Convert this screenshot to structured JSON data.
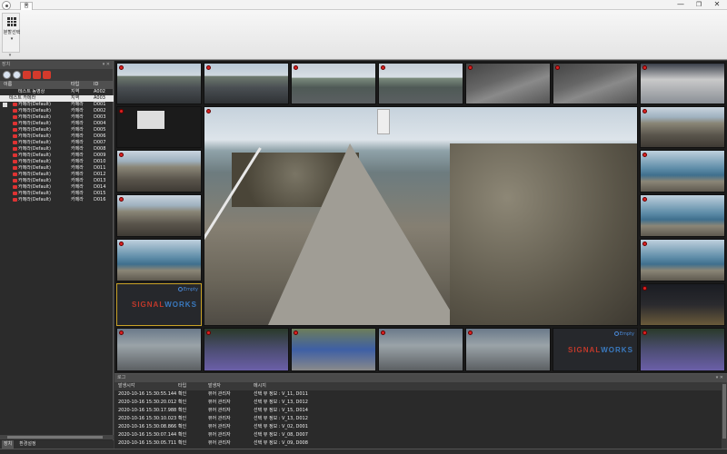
{
  "window": {
    "tab_label": "홈",
    "min_glyph": "—",
    "max_glyph": "❐",
    "close_glyph": "✕"
  },
  "ribbon": {
    "layout_button_label": "분할선택",
    "layout_caret": "▾",
    "expand_glyph": "▾"
  },
  "left_panel": {
    "title": "장치",
    "header_controls": "▾ ✕",
    "columns": {
      "name": "이름",
      "type": "타입",
      "id": "ID"
    },
    "rows": [
      {
        "name": "테스트 동영상",
        "type": "지역",
        "id": "A002",
        "kind": "group",
        "selected": false
      },
      {
        "name": "테스트 카메라",
        "type": "지역",
        "id": "A003",
        "kind": "group",
        "selected": true
      },
      {
        "name": "카메라(Default)",
        "type": "카메라",
        "id": "D001",
        "kind": "camera"
      },
      {
        "name": "카메라(Default)",
        "type": "카메라",
        "id": "D002",
        "kind": "camera"
      },
      {
        "name": "카메라(Default)",
        "type": "카메라",
        "id": "D003",
        "kind": "camera"
      },
      {
        "name": "카메라(Default)",
        "type": "카메라",
        "id": "D004",
        "kind": "camera"
      },
      {
        "name": "카메라(Default)",
        "type": "카메라",
        "id": "D005",
        "kind": "camera"
      },
      {
        "name": "카메라(Default)",
        "type": "카메라",
        "id": "D006",
        "kind": "camera"
      },
      {
        "name": "카메라(Default)",
        "type": "카메라",
        "id": "D007",
        "kind": "camera"
      },
      {
        "name": "카메라(Default)",
        "type": "카메라",
        "id": "D008",
        "kind": "camera"
      },
      {
        "name": "카메라(Default)",
        "type": "카메라",
        "id": "D009",
        "kind": "camera"
      },
      {
        "name": "카메라(Default)",
        "type": "카메라",
        "id": "D010",
        "kind": "camera"
      },
      {
        "name": "카메라(Default)",
        "type": "카메라",
        "id": "D011",
        "kind": "camera"
      },
      {
        "name": "카메라(Default)",
        "type": "카메라",
        "id": "D012",
        "kind": "camera"
      },
      {
        "name": "카메라(Default)",
        "type": "카메라",
        "id": "D013",
        "kind": "camera"
      },
      {
        "name": "카메라(Default)",
        "type": "카메라",
        "id": "D014",
        "kind": "camera"
      },
      {
        "name": "카메라(Default)",
        "type": "카메라",
        "id": "D015",
        "kind": "camera"
      },
      {
        "name": "카메라(Default)",
        "type": "카메라",
        "id": "D016",
        "kind": "camera"
      }
    ],
    "bottom_tabs": [
      "장치",
      "환경설정"
    ]
  },
  "video": {
    "empty_label": "Empty",
    "logo_text_red": "SIGNAL",
    "logo_text_blue": "WORKS"
  },
  "event_log": {
    "title": "로그",
    "header_controls": "▾ ✕",
    "columns": {
      "time": "발생시각",
      "type": "타입",
      "source": "발생자",
      "message": "메시지"
    },
    "rows": [
      {
        "time": "2020-10-16 15:30:55.144",
        "type": "확인",
        "source": "뷰어 관리자",
        "message": "선택 뷰 정보 : V_11, D011"
      },
      {
        "time": "2020-10-16 15:30:20.012",
        "type": "확인",
        "source": "뷰어 관리자",
        "message": "선택 뷰 정보 : V_13, D012"
      },
      {
        "time": "2020-10-16 15:30:17.988",
        "type": "확인",
        "source": "뷰어 관리자",
        "message": "선택 뷰 정보 : V_15, D014"
      },
      {
        "time": "2020-10-16 15:30:10.023",
        "type": "확인",
        "source": "뷰어 관리자",
        "message": "선택 뷰 정보 : V_13, D012"
      },
      {
        "time": "2020-10-16 15:30:08.866",
        "type": "확인",
        "source": "뷰어 관리자",
        "message": "선택 뷰 정보 : V_02, D001"
      },
      {
        "time": "2020-10-16 15:30:07.144",
        "type": "확인",
        "source": "뷰어 관리자",
        "message": "선택 뷰 정보 : V_08, D007"
      },
      {
        "time": "2020-10-16 15:30:05.711",
        "type": "확인",
        "source": "뷰어 관리자",
        "message": "선택 뷰 정보 : V_09, D008"
      }
    ]
  },
  "colors": {
    "accent_red": "#d43a2c",
    "logo_blue": "#3a7ac0",
    "selected_row": "#e8e8e8"
  }
}
